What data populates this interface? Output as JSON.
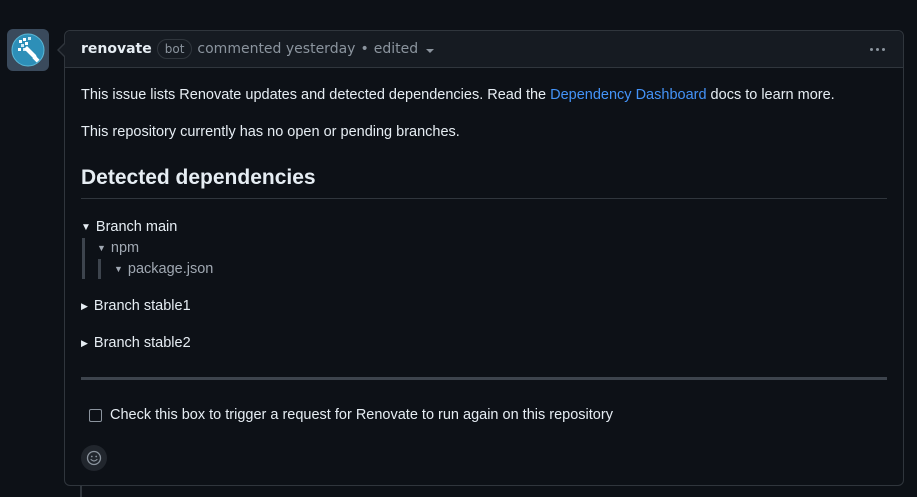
{
  "header": {
    "author": "renovate",
    "badge": "bot",
    "commented": "commented yesterday",
    "separator": "•",
    "edited": "edited"
  },
  "body": {
    "intro_before": "This issue lists Renovate updates and detected dependencies. Read the ",
    "intro_link": "Dependency Dashboard",
    "intro_after": " docs to learn more.",
    "status": "This repository currently has no open or pending branches.",
    "heading": "Detected dependencies",
    "tree": {
      "branch_main": "Branch main",
      "npm": "npm",
      "package_json": "package.json",
      "branch_stable1": "Branch stable1",
      "branch_stable2": "Branch stable2"
    },
    "checkbox_label": "Check this box to trigger a request for Renovate to run again on this repository"
  },
  "icons": {
    "avatar": "renovate-logo",
    "kebab": "kebab-horizontal-icon",
    "emoji": "smiley-icon",
    "edited_menu": "triangle-down-icon"
  },
  "colors": {
    "link": "#4493f8",
    "background": "#0d1117",
    "header_bg": "#161b22",
    "border": "#30363d"
  }
}
